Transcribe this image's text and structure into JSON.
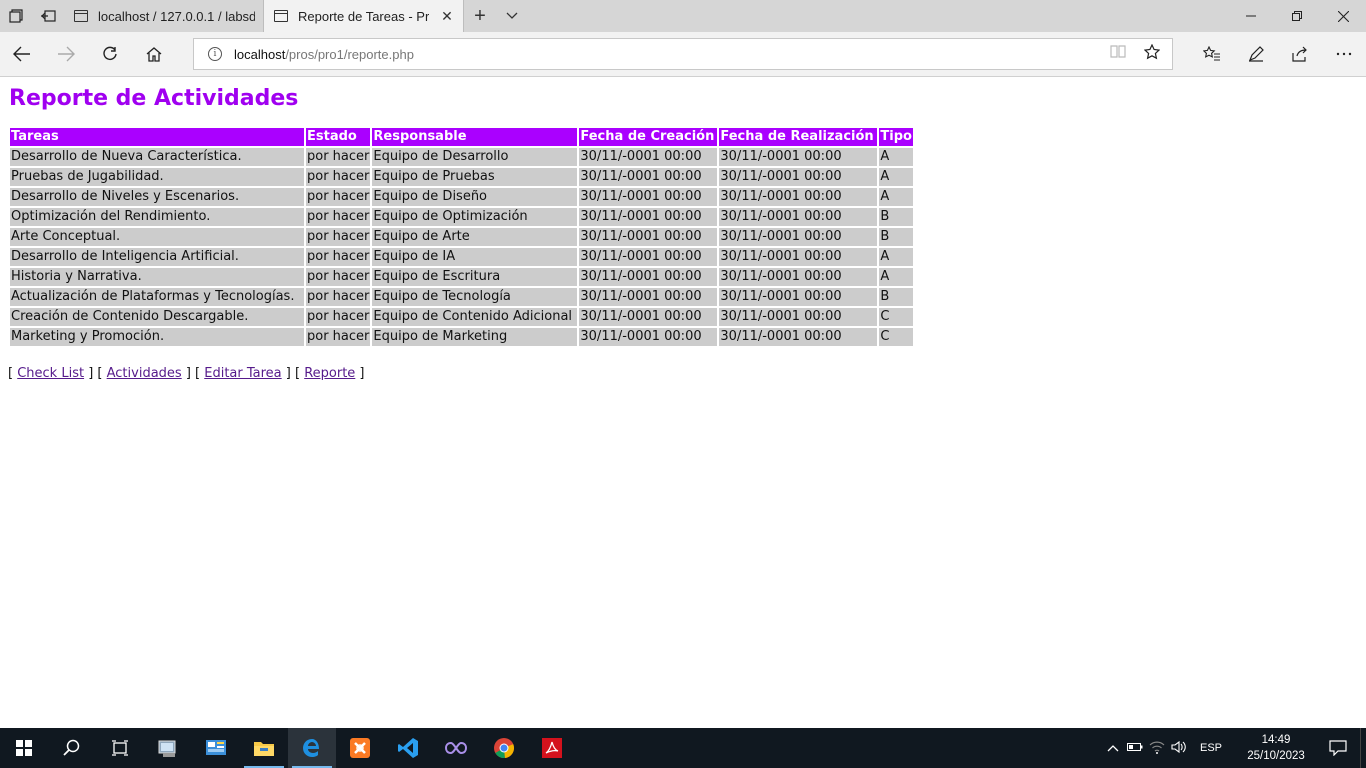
{
  "browser": {
    "tabs": [
      {
        "title": "localhost / 127.0.0.1 / labsd",
        "active": false
      },
      {
        "title": "Reporte de Tareas - Pro",
        "active": true
      }
    ],
    "address": {
      "host": "localhost",
      "path": "/pros/pro1/reporte.php"
    }
  },
  "page": {
    "title": "Reporte de Actividades",
    "table": {
      "headers": [
        "Tareas",
        "Estado",
        "Responsable",
        "Fecha de Creación",
        "Fecha de Realización",
        "Tipo"
      ],
      "rows": [
        [
          "Desarrollo de Nueva Característica.",
          "por hacer",
          "Equipo de Desarrollo",
          "30/11/-0001 00:00",
          "30/11/-0001 00:00",
          "A"
        ],
        [
          "Pruebas de Jugabilidad.",
          "por hacer",
          "Equipo de Pruebas",
          "30/11/-0001 00:00",
          "30/11/-0001 00:00",
          "A"
        ],
        [
          "Desarrollo de Niveles y Escenarios.",
          "por hacer",
          "Equipo de Diseño",
          "30/11/-0001 00:00",
          "30/11/-0001 00:00",
          "A"
        ],
        [
          "Optimización del Rendimiento.",
          "por hacer",
          "Equipo de Optimización",
          "30/11/-0001 00:00",
          "30/11/-0001 00:00",
          "B"
        ],
        [
          "Arte Conceptual.",
          "por hacer",
          "Equipo de Arte",
          "30/11/-0001 00:00",
          "30/11/-0001 00:00",
          "B"
        ],
        [
          "Desarrollo de Inteligencia Artificial.",
          "por hacer",
          "Equipo de IA",
          "30/11/-0001 00:00",
          "30/11/-0001 00:00",
          "A"
        ],
        [
          "Historia y Narrativa.",
          "por hacer",
          "Equipo de Escritura",
          "30/11/-0001 00:00",
          "30/11/-0001 00:00",
          "A"
        ],
        [
          "Actualización de Plataformas y Tecnologías.",
          "por hacer",
          "Equipo de Tecnología",
          "30/11/-0001 00:00",
          "30/11/-0001 00:00",
          "B"
        ],
        [
          "Creación de Contenido Descargable.",
          "por hacer",
          "Equipo de Contenido Adicional",
          "30/11/-0001 00:00",
          "30/11/-0001 00:00",
          "C"
        ],
        [
          "Marketing y Promoción.",
          "por hacer",
          "Equipo de Marketing",
          "30/11/-0001 00:00",
          "30/11/-0001 00:00",
          "C"
        ]
      ]
    },
    "links": [
      "Check List",
      "Actividades",
      "Editar Tarea",
      "Reporte"
    ],
    "colors": {
      "title": "#a000f0",
      "header_bg": "#aa00ff",
      "cell_bg": "#cccccc",
      "link": "#551a8b"
    }
  },
  "taskbar": {
    "apps": [
      "start-icon",
      "search-icon",
      "task-view-icon",
      "file-manager-icon",
      "control-panel-icon",
      "file-explorer-icon",
      "edge-icon",
      "xampp-icon",
      "vscode-icon",
      "visual-studio-icon",
      "chrome-icon",
      "acrobat-icon"
    ],
    "language": "ESP",
    "time": "14:49",
    "date": "25/10/2023"
  }
}
